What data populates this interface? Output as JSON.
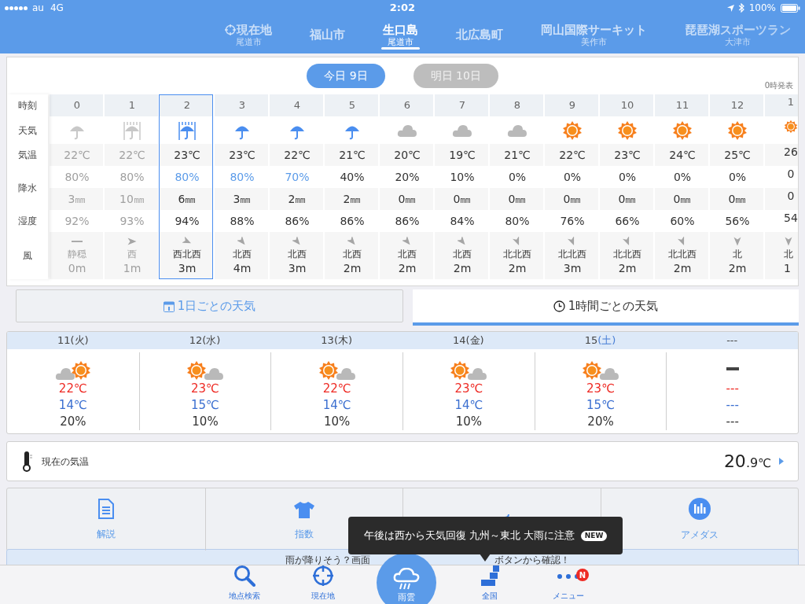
{
  "status_bar": {
    "carrier": "au",
    "network": "4G",
    "time": "2:02",
    "battery": "100%"
  },
  "locations": [
    {
      "name": "現在地",
      "sub": "尾道市",
      "current": true,
      "selected": false
    },
    {
      "name": "福山市",
      "current": false,
      "selected": false
    },
    {
      "name": "生口島",
      "sub": "尾道市",
      "current": false,
      "selected": true
    },
    {
      "name": "北広島町",
      "current": false,
      "selected": false
    },
    {
      "name": "岡山国際サーキット",
      "sub": "美作市",
      "current": false,
      "selected": false
    },
    {
      "name": "琵琶湖スポーツラン",
      "sub": "大津市",
      "current": false,
      "selected": false
    }
  ],
  "day_tabs": [
    {
      "label": "今日 9日",
      "selected": true
    },
    {
      "label": "明日 10日",
      "selected": false
    }
  ],
  "issued": "0時発表",
  "row_labels": {
    "time": "時刻",
    "weather": "天気",
    "temp": "気温",
    "precip": "降水",
    "humidity": "湿度",
    "wind": "風"
  },
  "hours": [
    {
      "hour": "0",
      "kind": "umbrella",
      "temp": "22℃",
      "pop": "80%",
      "pop_high": false,
      "rain": "3㎜",
      "humidity": "92%",
      "wind": {
        "kind": "calm",
        "direction": "静穏",
        "speed": "0m"
      },
      "past": true,
      "selected": false,
      "cut": false
    },
    {
      "hour": "1",
      "kind": "umbrella_heavy",
      "temp": "22℃",
      "pop": "80%",
      "pop_high": false,
      "rain": "10㎜",
      "humidity": "93%",
      "wind": {
        "kind": "w",
        "direction": "西",
        "speed": "1m"
      },
      "past": true,
      "selected": false,
      "cut": false
    },
    {
      "hour": "2",
      "kind": "umbrella_heavy",
      "temp": "23℃",
      "pop": "80%",
      "pop_high": true,
      "rain": "6㎜",
      "humidity": "94%",
      "wind": {
        "kind": "wnw",
        "direction": "西北西",
        "speed": "3m"
      },
      "past": false,
      "selected": true,
      "cut": false
    },
    {
      "hour": "3",
      "kind": "umbrella",
      "temp": "23℃",
      "pop": "80%",
      "pop_high": true,
      "rain": "3㎜",
      "humidity": "88%",
      "wind": {
        "kind": "nw",
        "direction": "北西",
        "speed": "4m"
      },
      "past": false,
      "selected": false,
      "cut": false
    },
    {
      "hour": "4",
      "kind": "umbrella",
      "temp": "22℃",
      "pop": "70%",
      "pop_high": true,
      "rain": "2㎜",
      "humidity": "86%",
      "wind": {
        "kind": "nw",
        "direction": "北西",
        "speed": "3m"
      },
      "past": false,
      "selected": false,
      "cut": false
    },
    {
      "hour": "5",
      "kind": "umbrella",
      "temp": "21℃",
      "pop": "40%",
      "pop_high": false,
      "rain": "2㎜",
      "humidity": "86%",
      "wind": {
        "kind": "nw",
        "direction": "北西",
        "speed": "2m"
      },
      "past": false,
      "selected": false,
      "cut": false
    },
    {
      "hour": "6",
      "kind": "cloud",
      "temp": "20℃",
      "pop": "20%",
      "pop_high": false,
      "rain": "0㎜",
      "humidity": "86%",
      "wind": {
        "kind": "nw",
        "direction": "北西",
        "speed": "2m"
      },
      "past": false,
      "selected": false,
      "cut": false
    },
    {
      "hour": "7",
      "kind": "cloud",
      "temp": "19℃",
      "pop": "10%",
      "pop_high": false,
      "rain": "0㎜",
      "humidity": "84%",
      "wind": {
        "kind": "nw",
        "direction": "北西",
        "speed": "2m"
      },
      "past": false,
      "selected": false,
      "cut": false
    },
    {
      "hour": "8",
      "kind": "cloud",
      "temp": "21℃",
      "pop": "0%",
      "pop_high": false,
      "rain": "0㎜",
      "humidity": "80%",
      "wind": {
        "kind": "nnw",
        "direction": "北北西",
        "speed": "2m"
      },
      "past": false,
      "selected": false,
      "cut": false
    },
    {
      "hour": "9",
      "kind": "sun",
      "temp": "22℃",
      "pop": "0%",
      "pop_high": false,
      "rain": "0㎜",
      "humidity": "76%",
      "wind": {
        "kind": "nnw",
        "direction": "北北西",
        "speed": "3m"
      },
      "past": false,
      "selected": false,
      "cut": false
    },
    {
      "hour": "10",
      "kind": "sun",
      "temp": "23℃",
      "pop": "0%",
      "pop_high": false,
      "rain": "0㎜",
      "humidity": "66%",
      "wind": {
        "kind": "nnw",
        "direction": "北北西",
        "speed": "2m"
      },
      "past": false,
      "selected": false,
      "cut": false
    },
    {
      "hour": "11",
      "kind": "sun",
      "temp": "24℃",
      "pop": "0%",
      "pop_high": false,
      "rain": "0㎜",
      "humidity": "60%",
      "wind": {
        "kind": "nnw",
        "direction": "北北西",
        "speed": "2m"
      },
      "past": false,
      "selected": false,
      "cut": false
    },
    {
      "hour": "12",
      "kind": "sun",
      "temp": "25℃",
      "pop": "0%",
      "pop_high": false,
      "rain": "0㎜",
      "humidity": "56%",
      "wind": {
        "kind": "n",
        "direction": "北",
        "speed": "2m"
      },
      "past": false,
      "selected": false,
      "cut": false
    },
    {
      "hour": "1",
      "kind": "sun",
      "temp": "26",
      "pop": "0",
      "pop_high": false,
      "rain": "0",
      "humidity": "54",
      "wind": {
        "kind": "n",
        "direction": "北",
        "speed": "1"
      },
      "past": false,
      "selected": false,
      "cut": true
    }
  ],
  "view_tabs": [
    {
      "label": "1日ごとの天気",
      "selected": false
    },
    {
      "label": "1時間ごとの天気",
      "selected": true
    }
  ],
  "days": [
    {
      "date": "11",
      "weekday": "(火)",
      "saturday": false,
      "kind": "cloud_sun",
      "high": "22℃",
      "low": "14℃",
      "pop": "20%"
    },
    {
      "date": "12",
      "weekday": "(水)",
      "saturday": false,
      "kind": "sun_cloud",
      "high": "23℃",
      "low": "15℃",
      "pop": "10%"
    },
    {
      "date": "13",
      "weekday": "(木)",
      "saturday": false,
      "kind": "sun_cloud",
      "high": "22℃",
      "low": "14℃",
      "pop": "10%"
    },
    {
      "date": "14",
      "weekday": "(金)",
      "saturday": false,
      "kind": "sun_cloud",
      "high": "23℃",
      "low": "14℃",
      "pop": "10%"
    },
    {
      "date": "15",
      "weekday": "(土)",
      "saturday": true,
      "kind": "sun_cloud",
      "high": "23℃",
      "low": "15℃",
      "pop": "20%"
    },
    {
      "date": "---",
      "kind": "none",
      "high": "---",
      "low": "---",
      "pop": "---"
    }
  ],
  "current_temp": {
    "label": "現在の気温",
    "value": "20",
    "decimal": ".9",
    "unit": "℃"
  },
  "menu": [
    {
      "label": "解説"
    },
    {
      "label": "指数"
    },
    {
      "label": "アメダス"
    }
  ],
  "banner": [
    "雨が降りそう？画面",
    "ボタンから確認！"
  ],
  "tooltip": {
    "text": "午後は西から天気回復 九州～東北 大雨に注意",
    "badge": "NEW"
  },
  "tab_bar": [
    {
      "label": "地点検索",
      "kind": "normal"
    },
    {
      "label": "現在地",
      "kind": "normal"
    },
    {
      "label": "雨雲",
      "kind": "main"
    },
    {
      "label": "全国",
      "kind": "normal"
    },
    {
      "label": "メニュー",
      "kind": "normal",
      "badge": "N"
    }
  ]
}
